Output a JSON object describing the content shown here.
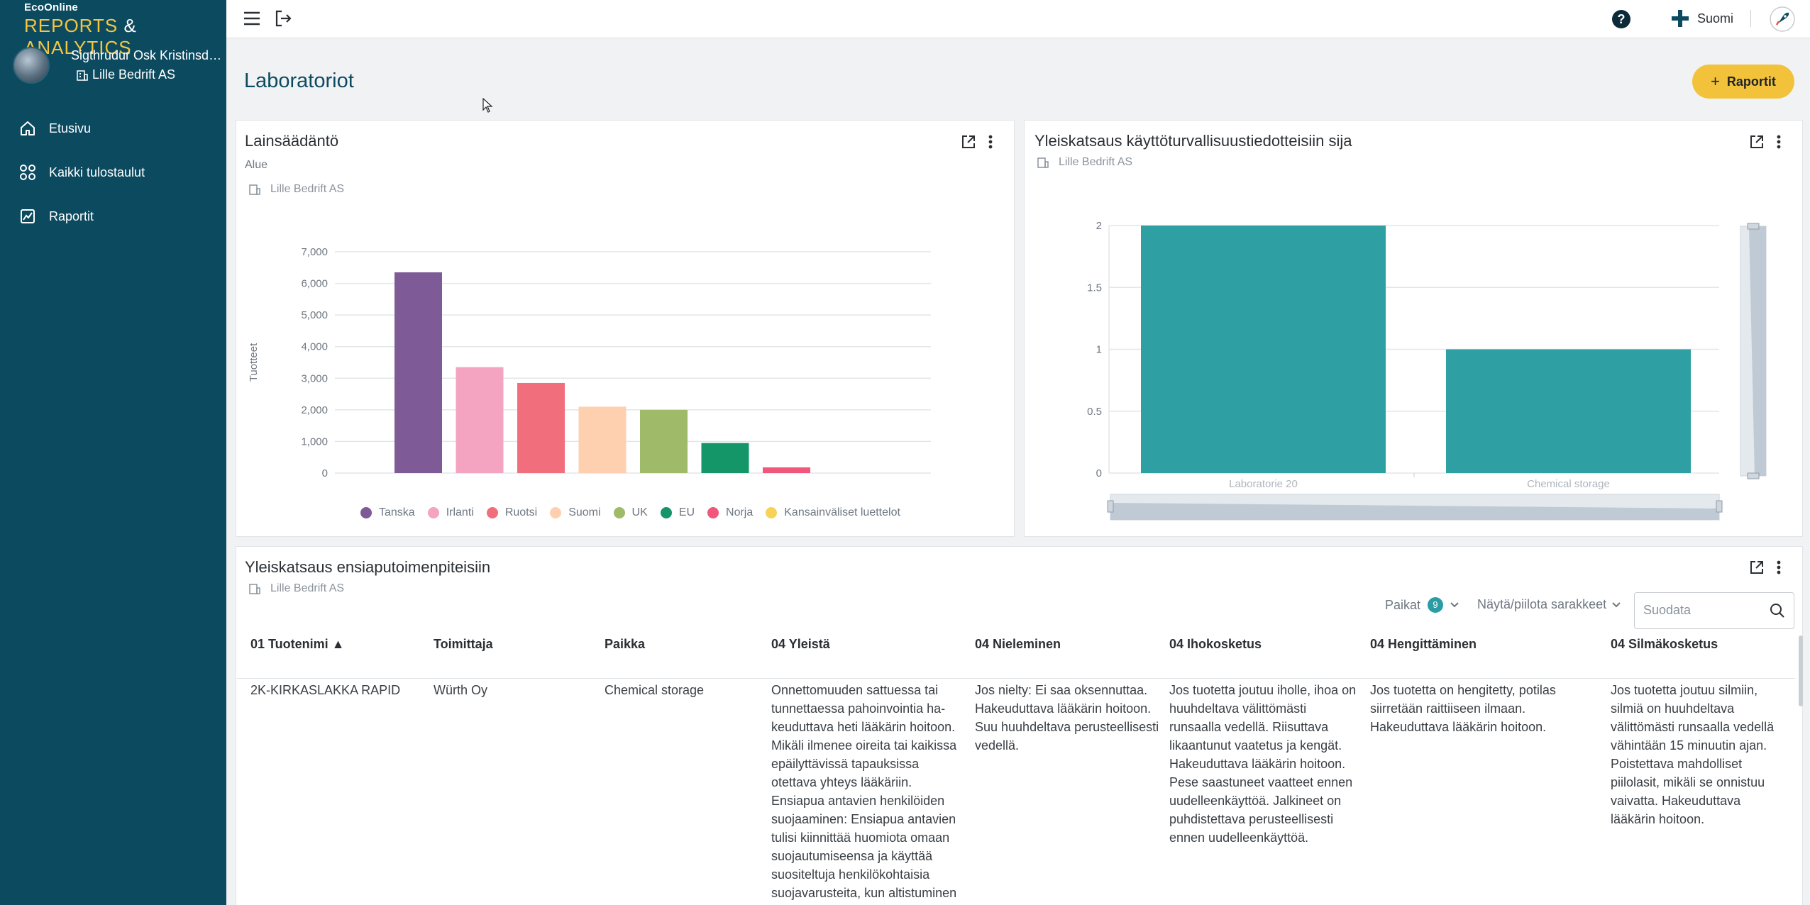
{
  "brand": {
    "small": "EcoOnline",
    "reports": "REPORTS",
    "amp": "&",
    "analytics": "ANALYTICS"
  },
  "user": {
    "name": "Sigthrudur Osk Kristinsdot...",
    "company": "Lille Bedrift AS"
  },
  "nav": [
    {
      "label": "Etusivu",
      "icon": "home-icon"
    },
    {
      "label": "Kaikki tulostaulut",
      "icon": "grid-icon"
    },
    {
      "label": "Raportit",
      "icon": "image-chart-icon"
    }
  ],
  "topbar": {
    "language": "Suomi"
  },
  "page": {
    "title": "Laboratoriot",
    "reports_button": "Raportit"
  },
  "card1": {
    "title": "Lainsäädäntö",
    "subtitle": "Alue",
    "company": "Lille Bedrift AS"
  },
  "card2": {
    "title": "Yleiskatsaus käyttöturvallisuustiedotteisiin sija",
    "company": "Lille Bedrift AS"
  },
  "card3": {
    "title": "Yleiskatsaus ensiaputoimenpiteisiin",
    "company": "Lille Bedrift AS",
    "places_label": "Paikat",
    "places_count": "9",
    "columns_toggle": "Näytä/piilota sarakkeet",
    "search_placeholder": "Suodata"
  },
  "table": {
    "headers": [
      "01 Tuotenimi ▲",
      "Toimittaja",
      "Paikka",
      "04 Yleistä",
      "04 Nieleminen",
      "04 Ihokosketus",
      "04 Hengittäminen",
      "04 Silmäkosketus"
    ],
    "rows": [
      {
        "name": "2K-KIRKASLAKKA RAPID",
        "supplier": "Würth Oy",
        "place": "Chemical storage",
        "general": [
          "Onnettomuuden sattuessa tai",
          "tunnettaessa pahoinvointia ha-",
          "keuduttava heti lääkärin hoitoon.",
          "Mikäli ilmenee oireita tai kaikissa",
          "epäilyttävissä tapauksissa",
          "otettava yhteys lääkäriin.",
          "Ensiapua antavien henkilöiden",
          "suojaaminen: Ensiapua antavien",
          "tulisi kiinnittää huomiota omaan",
          "suojautumiseensa ja käyttää",
          "suositeltuja henkilökohtaisia",
          "suojavarusteita, kun altistuminen"
        ],
        "ingestion": [
          "Jos nielty: Ei saa oksennuttaa.",
          "Hakeuduttava lääkärin hoitoon.",
          "Suu huuhdeltava perusteellisesti",
          "vedellä."
        ],
        "skin": [
          "Jos tuotetta joutuu iholle, ihoa on",
          "huuhdeltava välittömästi",
          "runsaalla vedellä. Riisuttava",
          "likaantunut vaatetus ja kengät.",
          "Hakeuduttava lääkärin hoitoon.",
          "Pese saastuneet vaatteet ennen",
          "uudelleenkäyttöä. Jalkineet on",
          "puhdistettava perusteellisesti",
          "ennen uudelleenkäyttöä."
        ],
        "inhalation": [
          "Jos tuotetta on hengitetty, potilas",
          "siirretään raittiiseen ilmaan.",
          "Hakeuduttava lääkärin hoitoon."
        ],
        "eye": [
          "Jos tuotetta joutuu silmiin,",
          "silmiä on huuhdeltava",
          "välittömästi runsaalla vedellä",
          "vähintään 15 minuutin ajan.",
          "Poistettava mahdolliset",
          "piilolasit, mikäli se onnistuu",
          "vaivatta. Hakeuduttava",
          "lääkärin hoitoon."
        ]
      }
    ]
  },
  "chart_data": [
    {
      "type": "bar",
      "title": "Lainsäädäntö",
      "ylabel": "Tuotteet",
      "ylim": [
        0,
        7000
      ],
      "yticks": [
        "0",
        "1,000",
        "2,000",
        "3,000",
        "4,000",
        "5,000",
        "6,000",
        "7,000"
      ],
      "categories": [
        "Tanska",
        "Irlanti",
        "Ruotsi",
        "Suomi",
        "UK",
        "EU",
        "Norja",
        "Kansainväliset luettelot"
      ],
      "values": [
        6350,
        3350,
        2850,
        2100,
        2000,
        950,
        180,
        0
      ],
      "colors": [
        "#7e5a96",
        "#f4a3c0",
        "#f16f7c",
        "#ffd0b0",
        "#9fbb6a",
        "#149668",
        "#f0577a",
        "#f8d257"
      ],
      "legend": "bottom"
    },
    {
      "type": "bar",
      "title": "Yleiskatsaus käyttöturvallisuustiedotteisiin sija",
      "ylim": [
        0,
        2
      ],
      "yticks": [
        "0",
        "0.5",
        "1",
        "1.5",
        "2"
      ],
      "categories": [
        "Laboratorie 20",
        "Chemical storage"
      ],
      "values": [
        2,
        1
      ],
      "color": "#2e9fa3"
    }
  ]
}
